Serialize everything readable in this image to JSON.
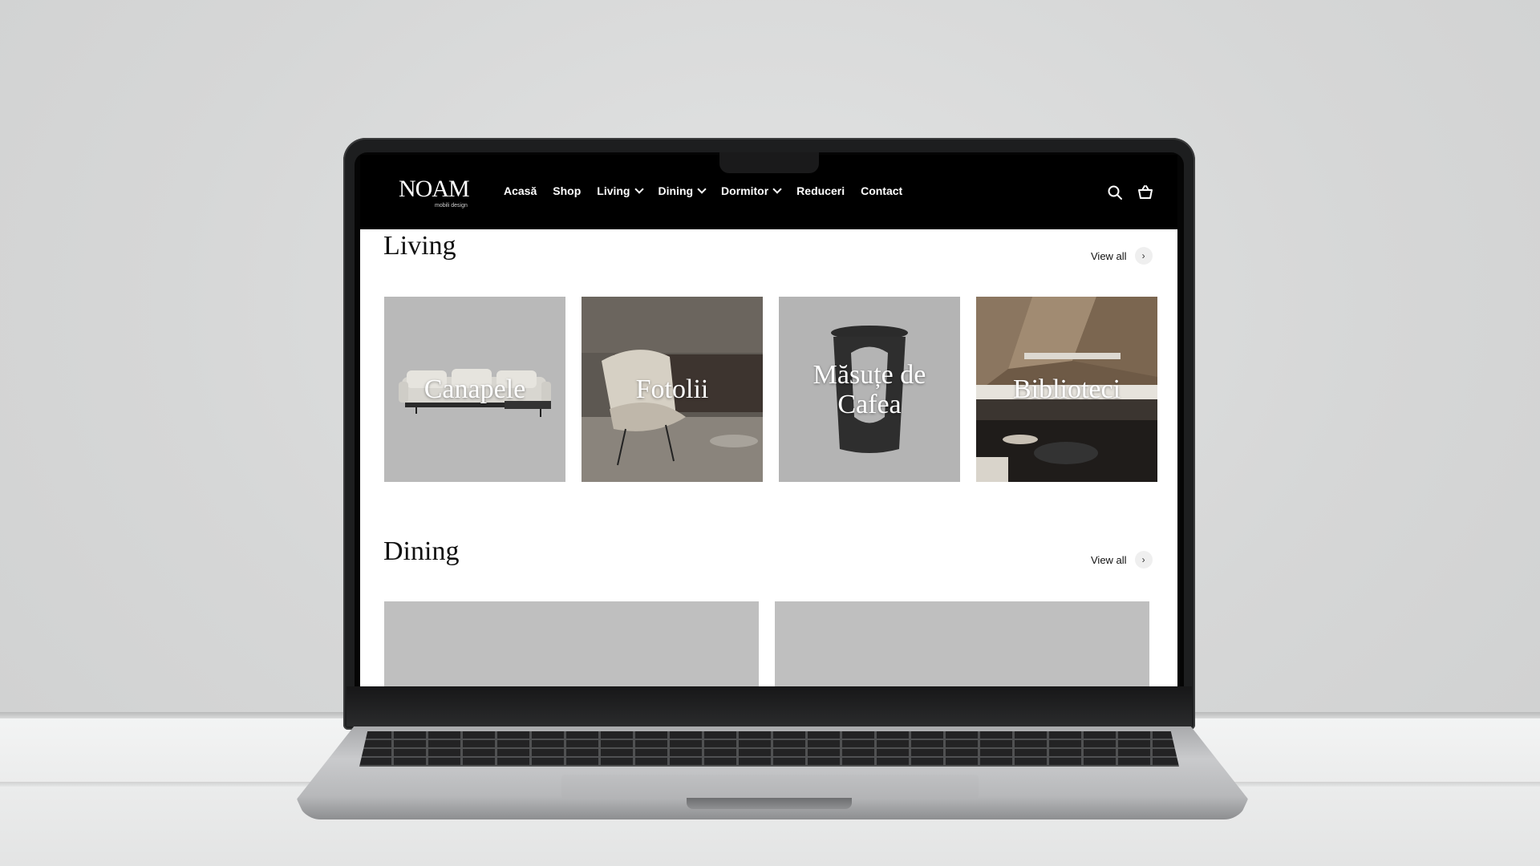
{
  "brand": {
    "logo_text": "NOAM",
    "logo_sub": "mobili design"
  },
  "nav": {
    "items": [
      {
        "label": "Acasă",
        "dropdown": false
      },
      {
        "label": "Shop",
        "dropdown": false
      },
      {
        "label": "Living",
        "dropdown": true
      },
      {
        "label": "Dining",
        "dropdown": true
      },
      {
        "label": "Dormitor",
        "dropdown": true
      },
      {
        "label": "Reduceri",
        "dropdown": false
      },
      {
        "label": "Contact",
        "dropdown": false
      }
    ],
    "icons": [
      "search-icon",
      "cart-icon"
    ]
  },
  "living": {
    "title": "Living",
    "view_all": "View all",
    "cards": [
      {
        "label": "Canapele",
        "image": "sofa"
      },
      {
        "label": "Fotolii",
        "image": "armchair"
      },
      {
        "label": "Măsuțe de Cafea",
        "image": "coffee-table"
      },
      {
        "label": "Biblioteci",
        "image": "bookshelf-room"
      }
    ]
  },
  "dining": {
    "title": "Dining",
    "view_all": "View all"
  },
  "colors": {
    "header_bg": "#000000",
    "card_gray": "#b9b9b9",
    "page_bg": "#ffffff"
  }
}
